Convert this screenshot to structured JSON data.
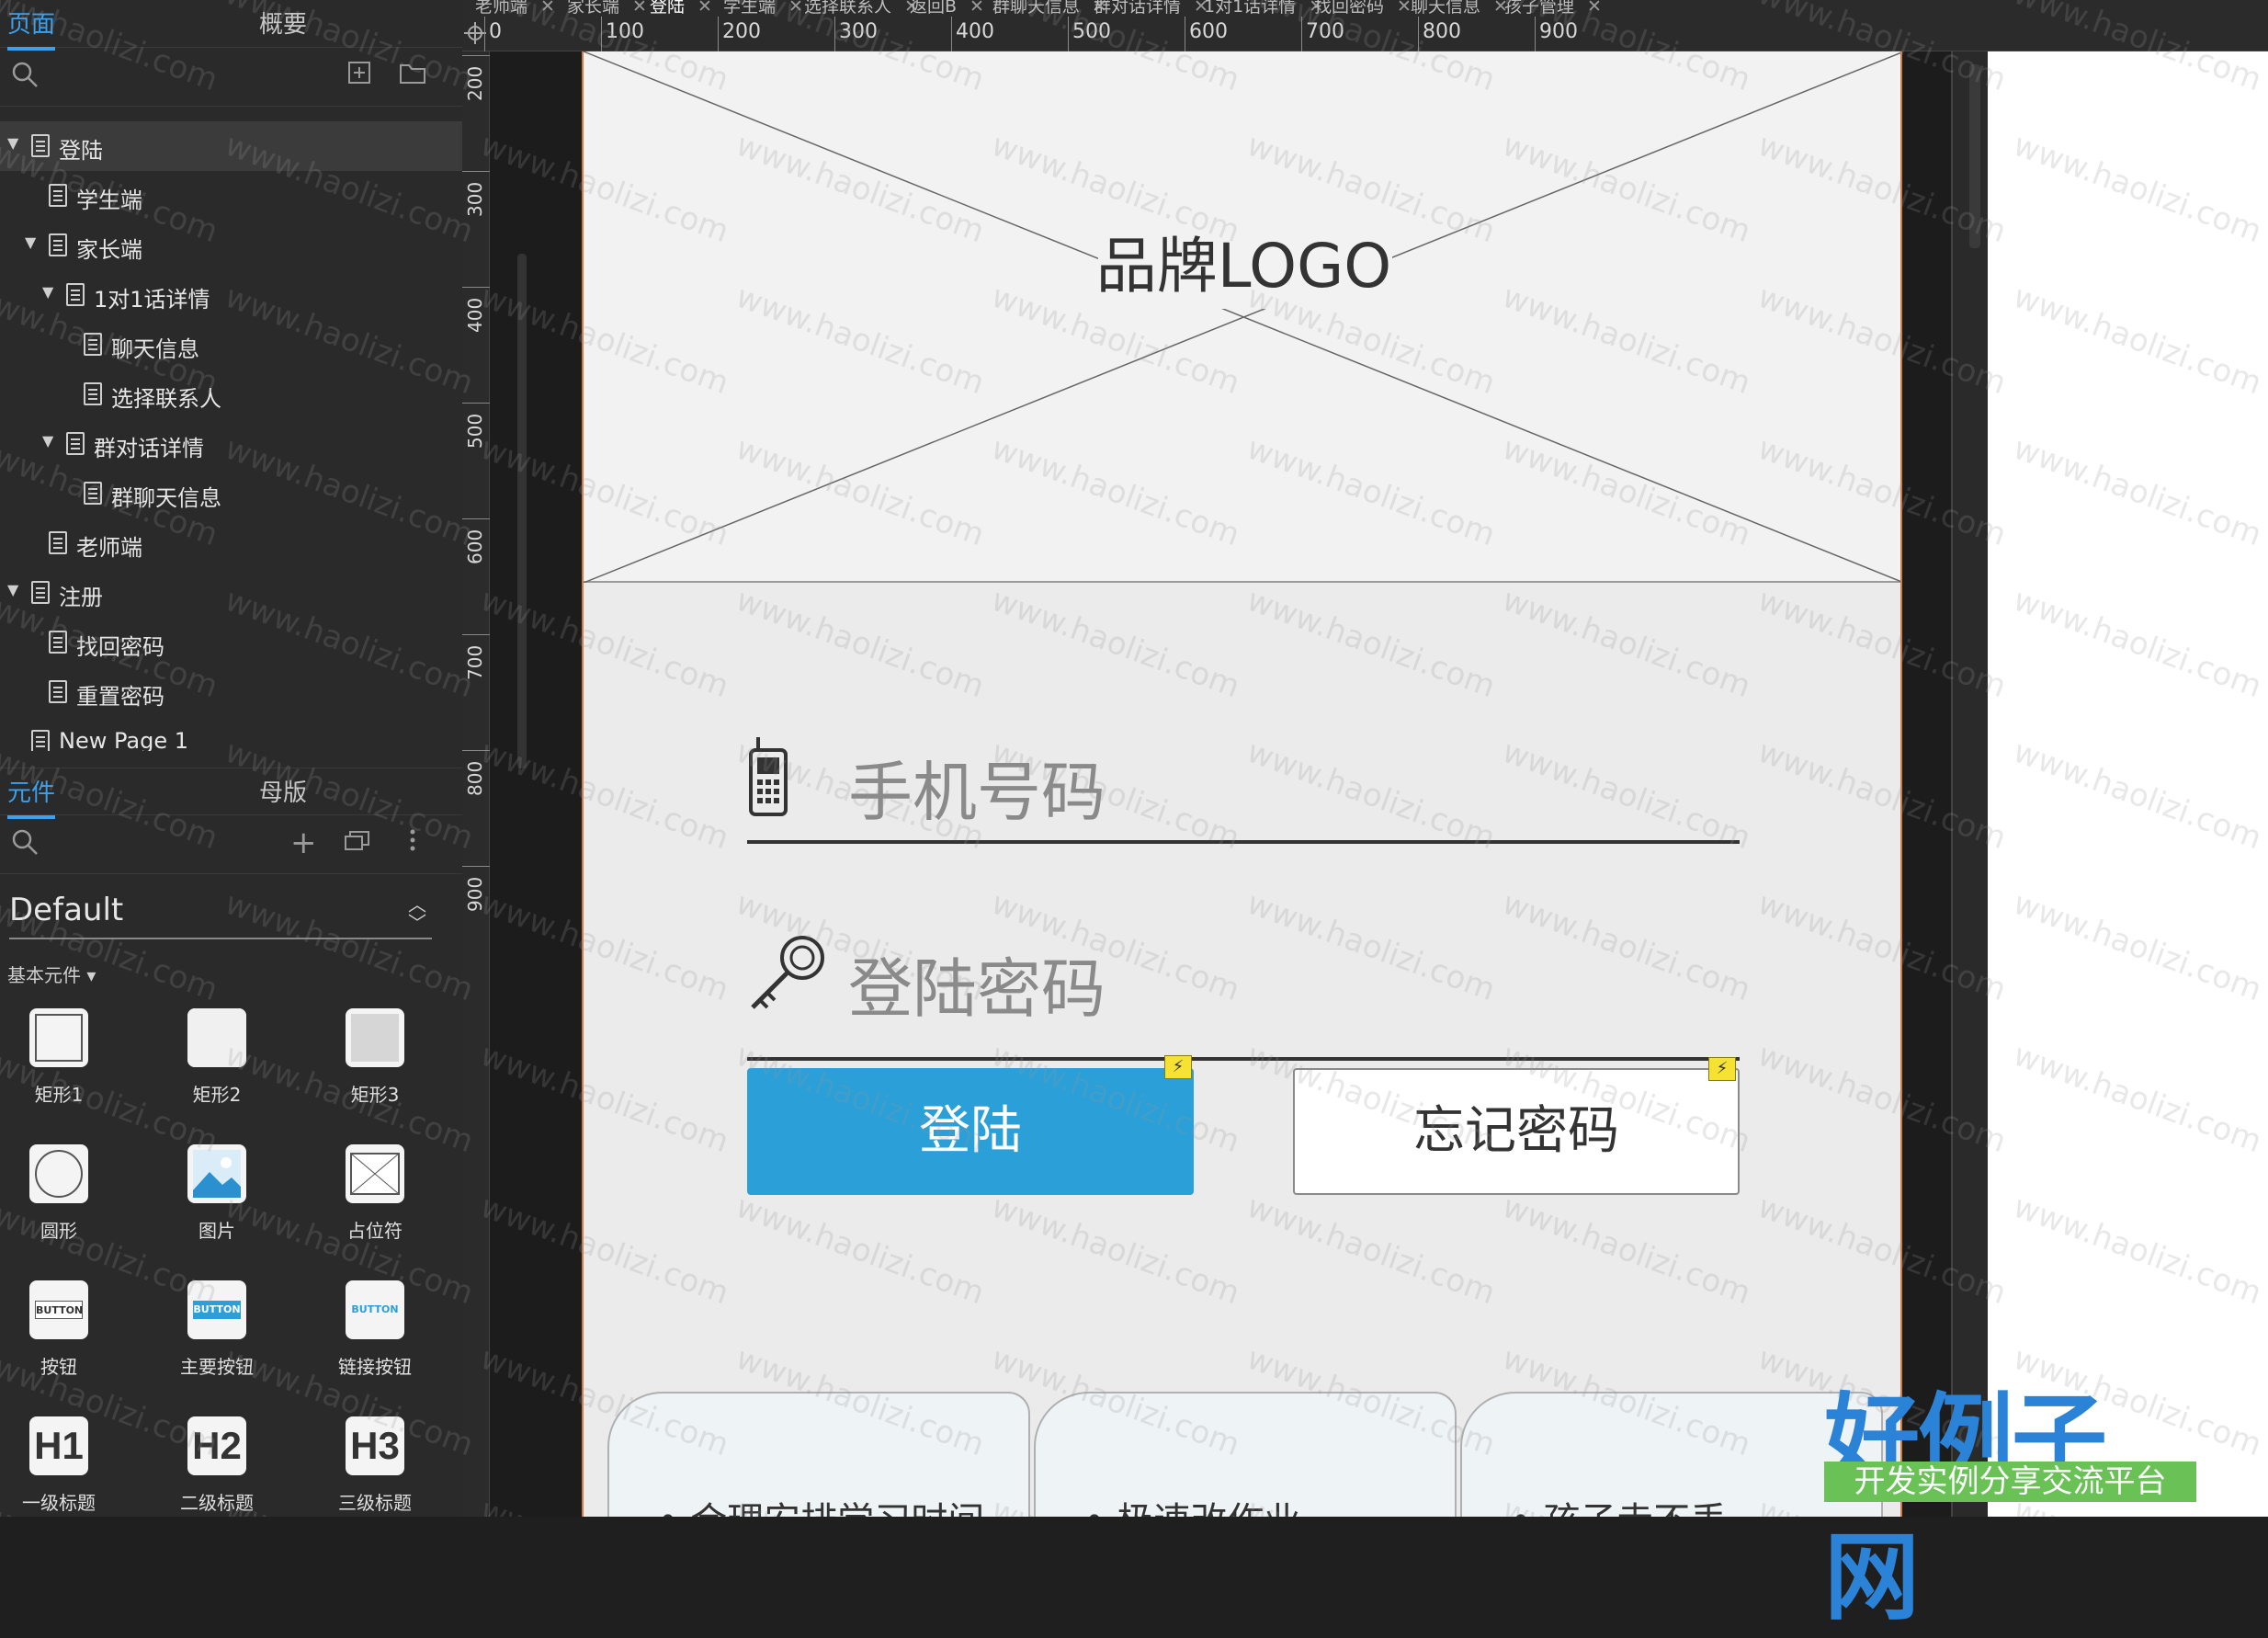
{
  "left_panel": {
    "pages_tabs": [
      "页面",
      "概要"
    ],
    "pages_tree": [
      {
        "label": "登陆",
        "level": 0,
        "expanded": true,
        "selected": true
      },
      {
        "label": "学生端",
        "level": 1
      },
      {
        "label": "家长端",
        "level": 1,
        "expanded": true
      },
      {
        "label": "1对1话详情",
        "level": 2,
        "expanded": true
      },
      {
        "label": "聊天信息",
        "level": 3
      },
      {
        "label": "选择联系人",
        "level": 3
      },
      {
        "label": "群对话详情",
        "level": 2,
        "expanded": true
      },
      {
        "label": "群聊天信息",
        "level": 3
      },
      {
        "label": "老师端",
        "level": 1
      },
      {
        "label": "注册",
        "level": 0,
        "expanded": true
      },
      {
        "label": "找回密码",
        "level": 1
      },
      {
        "label": "重置密码",
        "level": 1
      },
      {
        "label": "New Page 1",
        "level": 0
      }
    ],
    "library_tabs": [
      "元件",
      "母版"
    ],
    "library_name": "Default",
    "section_label": "基本元件 ▾",
    "widgets": [
      {
        "label": "矩形1",
        "icon": "rect1-icon"
      },
      {
        "label": "矩形2",
        "icon": "rect2-icon"
      },
      {
        "label": "矩形3",
        "icon": "rect3-icon"
      },
      {
        "label": "圆形",
        "icon": "circle-icon"
      },
      {
        "label": "图片",
        "icon": "image-icon"
      },
      {
        "label": "占位符",
        "icon": "placeholder-icon"
      },
      {
        "label": "按钮",
        "icon": "button-icon",
        "text": "BUTTON"
      },
      {
        "label": "主要按钮",
        "icon": "primary-button-icon",
        "text": "BUTTON"
      },
      {
        "label": "链接按钮",
        "icon": "link-button-icon",
        "text": "BUTTON"
      },
      {
        "label": "一级标题",
        "icon": "h1-icon",
        "text": "H1"
      },
      {
        "label": "二级标题",
        "icon": "h2-icon",
        "text": "H2"
      },
      {
        "label": "三级标题",
        "icon": "h3-icon",
        "text": "H3"
      }
    ]
  },
  "doc_tabs": [
    "老师端",
    "家长端",
    "登陆",
    "学生端",
    "选择联系人",
    "返回B",
    "群聊天信息",
    "群对话详情",
    "1对1话详情",
    "找回密码",
    "聊天信息",
    "孩子管理"
  ],
  "active_doc_tab": "登陆",
  "ruler_top": [
    "0",
    "100",
    "200",
    "300",
    "400",
    "500",
    "600",
    "700",
    "800",
    "900"
  ],
  "ruler_left": [
    "200",
    "300",
    "400",
    "500",
    "600",
    "700",
    "800",
    "900"
  ],
  "screen": {
    "logo_text": "品牌LOGO",
    "phone_placeholder": "手机号码",
    "password_placeholder": "登陆密码",
    "login_button": "登陆",
    "forgot_button": "忘记密码",
    "cards": [
      "• 合理安排学习时间",
      "• 极速改作业",
      "• 孩子走不丢"
    ]
  },
  "watermark": {
    "text": "www.haolizi.com",
    "brand_big": "好例子网",
    "brand_small": "开发实例分享交流平台"
  },
  "colors": {
    "accent": "#3aa0f0",
    "primary_button": "#2a9fd8",
    "panel_bg": "#2a2a2a",
    "brand_blue": "#2a83d6",
    "brand_green": "#6ac257"
  }
}
